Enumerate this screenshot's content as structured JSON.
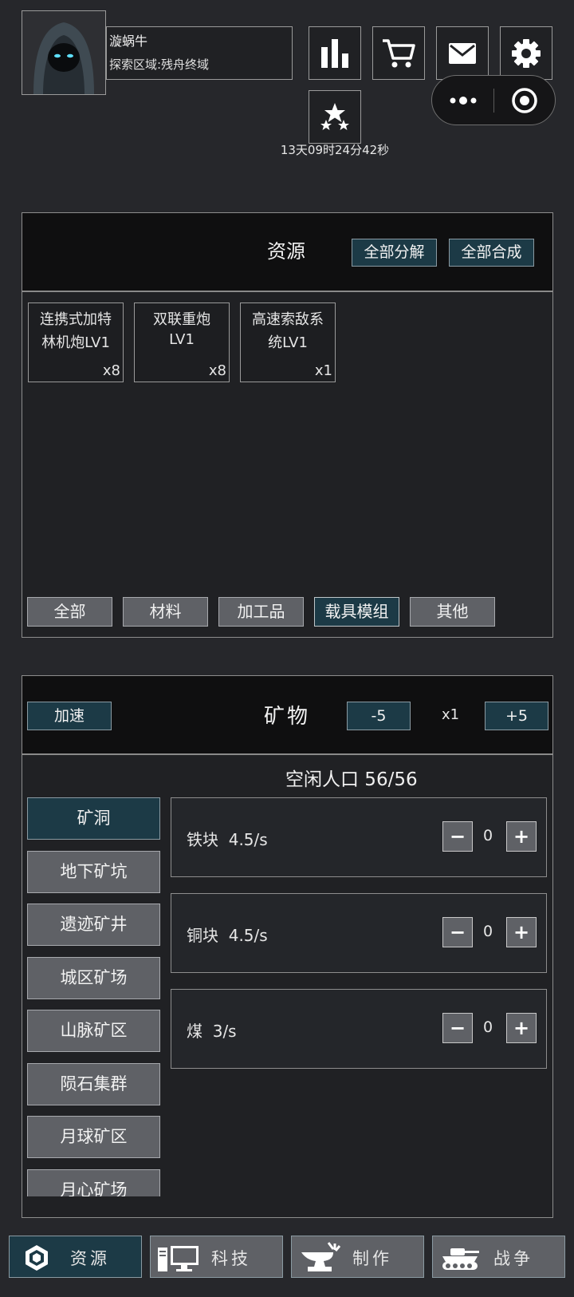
{
  "player": {
    "name": "漩蜗牛",
    "area": "探索区域:残舟终域"
  },
  "timer": "13天09时24分42秒",
  "top_icons": [
    "bar-chart-icon",
    "cart-icon",
    "mail-icon",
    "gear-icon",
    "stars-icon"
  ],
  "capsule": {
    "more": "more-dots-icon",
    "close": "target-icon"
  },
  "resources": {
    "title": "资源",
    "decompose_all": "全部分解",
    "craft_all": "全部合成",
    "items": [
      {
        "name": "连携式加特林机炮LV1",
        "line1": "连携式加特",
        "line2": "林机炮LV1",
        "count": "x8"
      },
      {
        "name": "双联重炮LV1",
        "line1": "双联重炮",
        "line2": "LV1",
        "count": "x8"
      },
      {
        "name": "高速索敌系统LV1",
        "line1": "高速索敌系",
        "line2": "统LV1",
        "count": "x1"
      }
    ],
    "filters": [
      "全部",
      "材料",
      "加工品",
      "载具模组",
      "其他"
    ],
    "active_filter": "载具模组"
  },
  "minerals": {
    "title": "矿物",
    "speed_up": "加速",
    "minus5": "-5",
    "multiplier": "x1",
    "plus5": "+5",
    "idle_label": "空闲人口 56/56",
    "locations": [
      "矿洞",
      "地下矿坑",
      "遗迹矿井",
      "城区矿场",
      "山脉矿区",
      "陨石集群",
      "月球矿区",
      "月心矿场"
    ],
    "active_location": "矿洞",
    "rows": [
      {
        "name": "铁块  4.5/s",
        "value": "0",
        "minus": "−",
        "plus": "+"
      },
      {
        "name": "铜块  4.5/s",
        "value": "0",
        "minus": "−",
        "plus": "+"
      },
      {
        "name": "煤  3/s",
        "value": "0",
        "minus": "−",
        "plus": "+"
      }
    ]
  },
  "bottom_nav": [
    {
      "label": "资源",
      "icon": "resource-gem-icon"
    },
    {
      "label": "科技",
      "icon": "computer-icon"
    },
    {
      "label": "制作",
      "icon": "anvil-icon"
    },
    {
      "label": "战争",
      "icon": "tank-icon"
    }
  ],
  "colors": {
    "background": "#26272b",
    "accent_active": "#1c3a46",
    "button_grey": "#5f6166"
  }
}
